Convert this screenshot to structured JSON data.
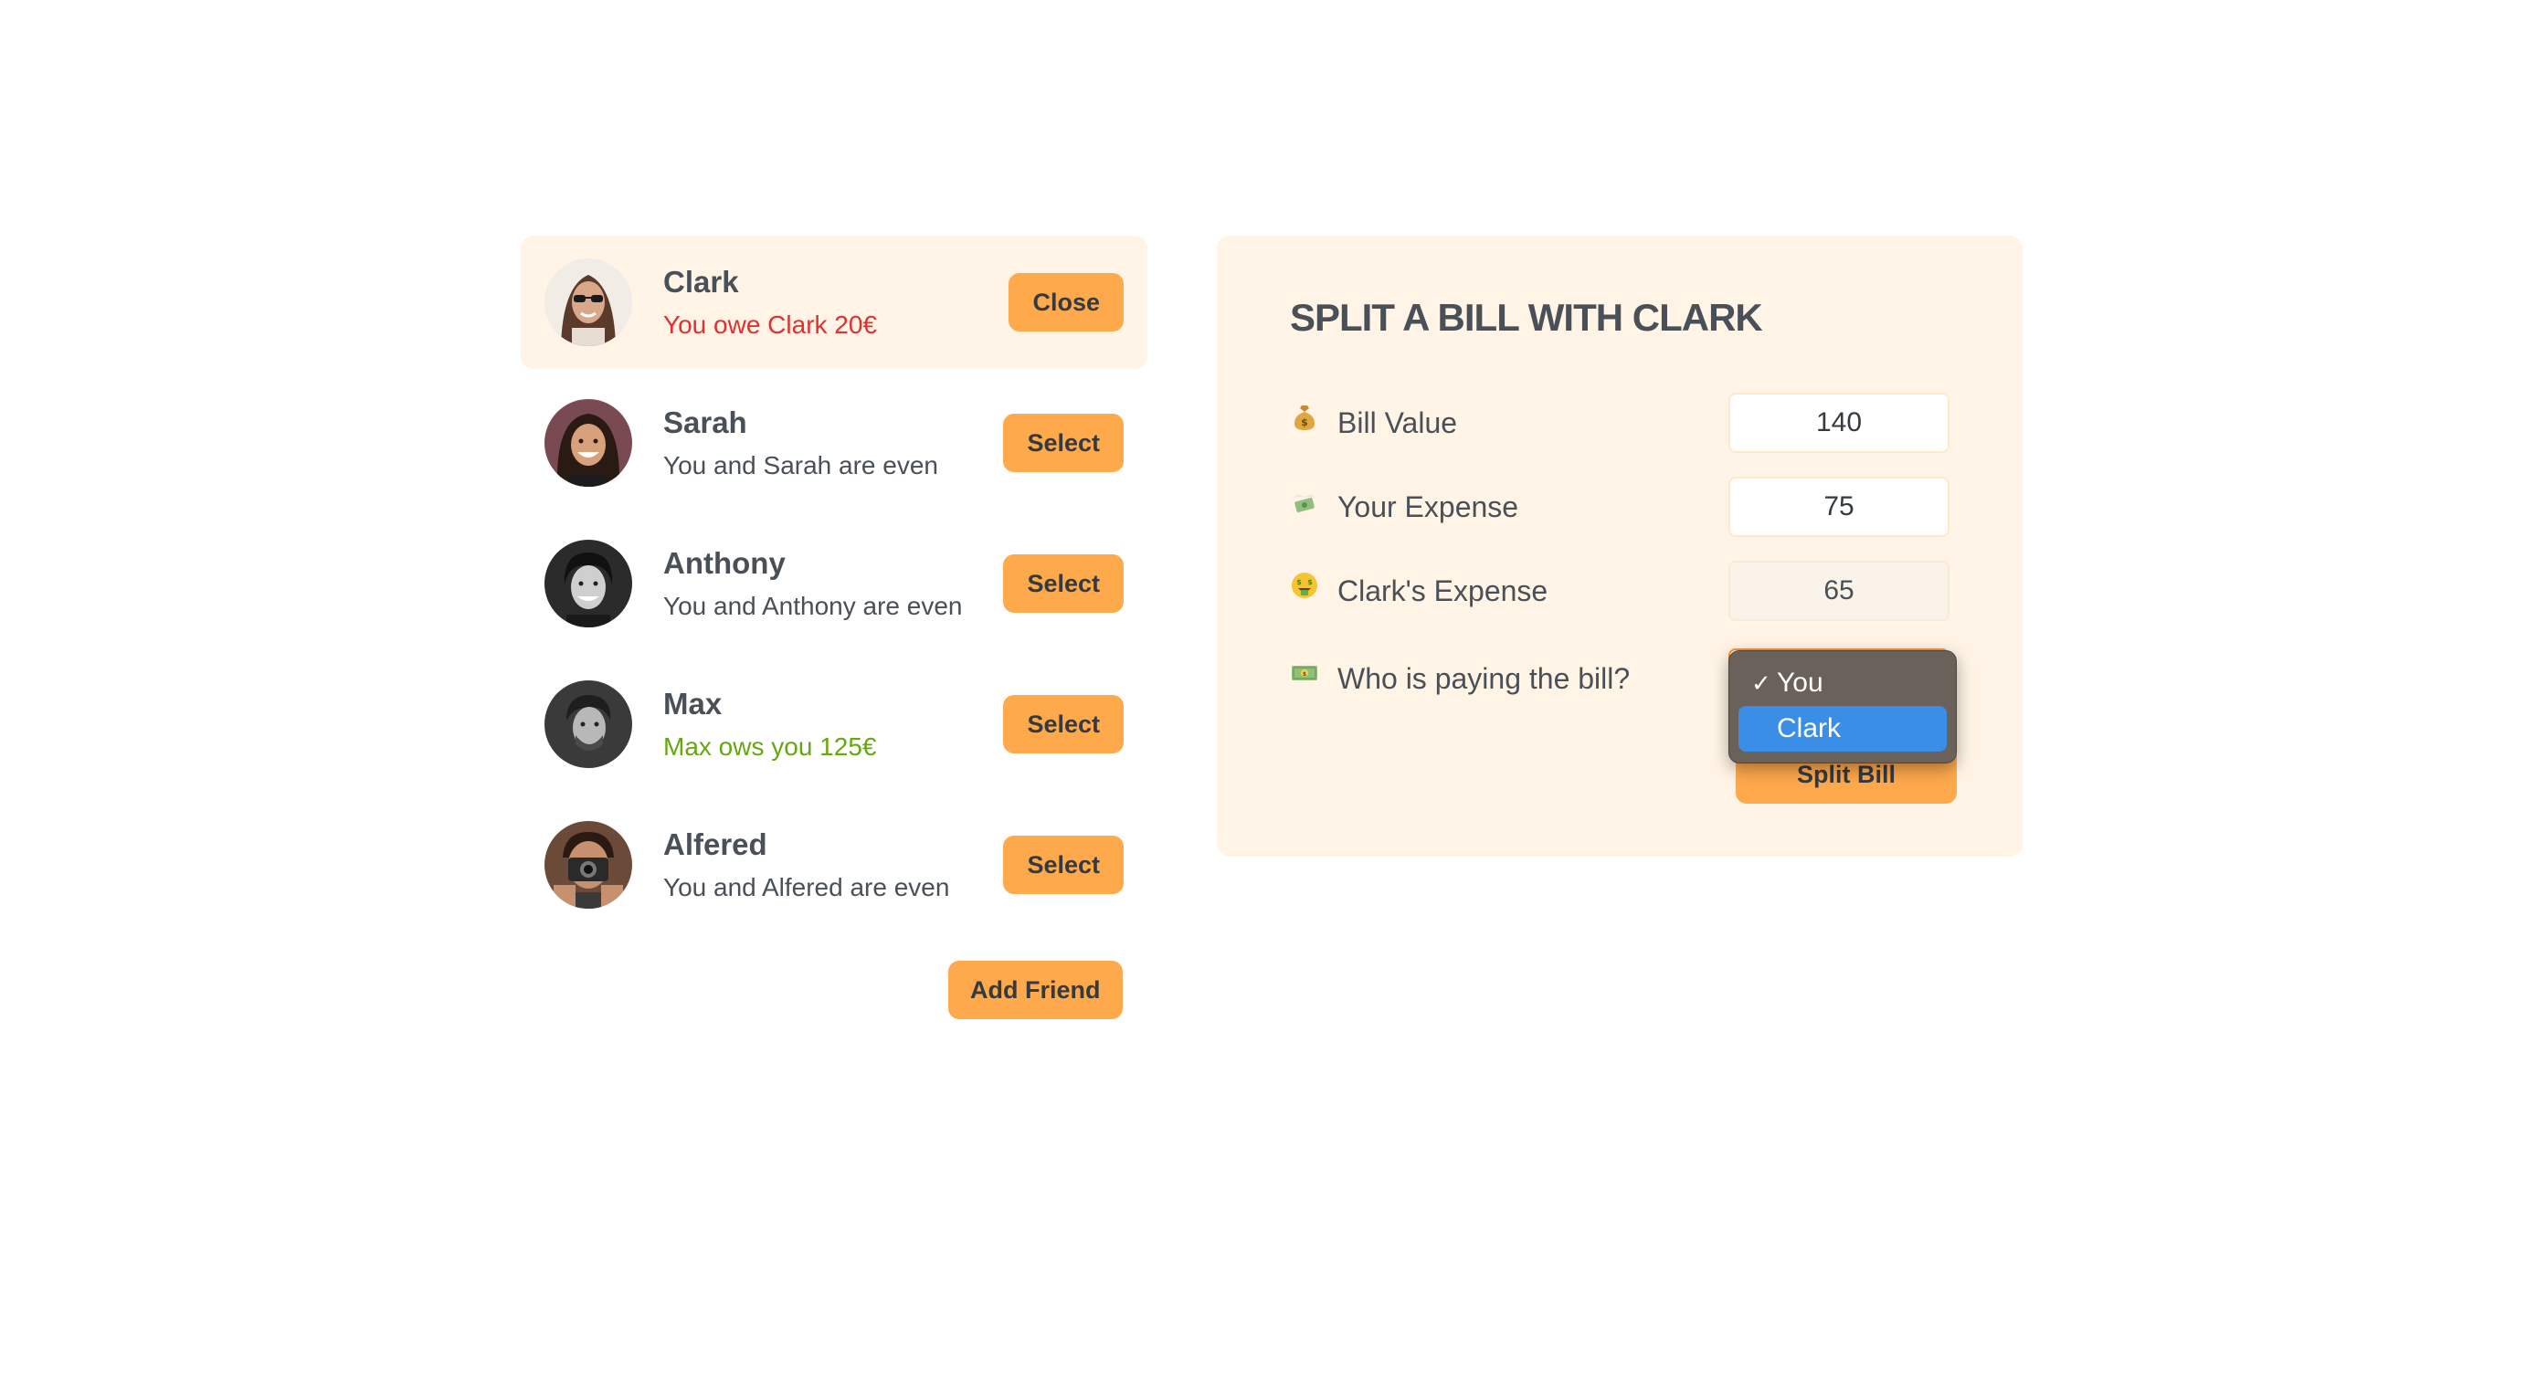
{
  "friends": [
    {
      "name": "Clark",
      "balance": "You owe Clark 20€",
      "balance_type": "red",
      "button": "Close",
      "selected": true,
      "avatar": "avatar-clark"
    },
    {
      "name": "Sarah",
      "balance": "You and Sarah are even",
      "balance_type": "even",
      "button": "Select",
      "selected": false,
      "avatar": "avatar-sarah"
    },
    {
      "name": "Anthony",
      "balance": "You and Anthony are even",
      "balance_type": "even",
      "button": "Select",
      "selected": false,
      "avatar": "avatar-anthony"
    },
    {
      "name": "Max",
      "balance": "Max ows you 125€",
      "balance_type": "green",
      "button": "Select",
      "selected": false,
      "avatar": "avatar-max"
    },
    {
      "name": "Alfered",
      "balance": "You and Alfered are even",
      "balance_type": "even",
      "button": "Select",
      "selected": false,
      "avatar": "avatar-alfered"
    }
  ],
  "add_friend_label": "Add Friend",
  "split_form": {
    "title": "SPLIT A BILL WITH CLARK",
    "bill_value_label": "Bill Value",
    "bill_value_icon": "money-bag-icon",
    "bill_value": "140",
    "your_expense_label": "Your Expense",
    "your_expense_icon": "money-with-wings-icon",
    "your_expense": "75",
    "friend_expense_label": "Clark's Expense",
    "friend_expense_icon": "money-mouth-face-icon",
    "friend_expense": "65",
    "payer_label": "Who is paying the bill?",
    "payer_icon": "banknote-icon",
    "payer_options": [
      {
        "label": "You",
        "checked": true,
        "highlighted": false
      },
      {
        "label": "Clark",
        "checked": false,
        "highlighted": true
      }
    ],
    "check_glyph": "✓",
    "submit_label": "Split Bill"
  },
  "colors": {
    "accent": "#ffa94d",
    "panel_bg": "#fff4e6",
    "owe_red": "#e03131",
    "owed_green": "#66a80f",
    "text": "#495057",
    "dropdown_highlight": "#3a8ee6"
  }
}
